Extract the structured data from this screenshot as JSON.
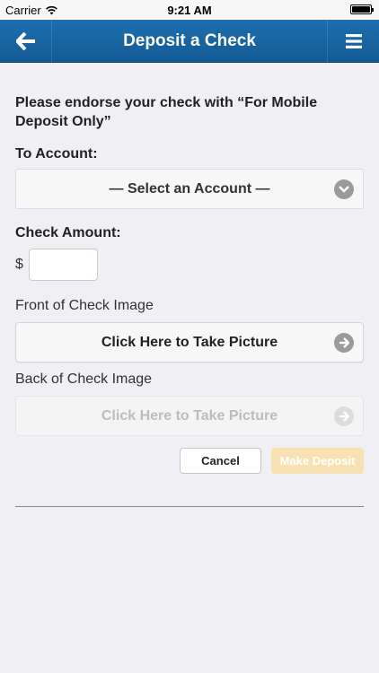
{
  "status_bar": {
    "carrier": "Carrier",
    "time": "9:21 AM",
    "battery_level": 1.0
  },
  "nav": {
    "title": "Deposit a Check",
    "back_icon": "back-arrow-icon",
    "menu_icon": "hamburger-menu-icon",
    "color": "#1a66a6"
  },
  "form": {
    "instruction": "Please endorse your check with “For Mobile Deposit Only”",
    "to_account_label": "To Account:",
    "account_select_value": "— Select an Account —",
    "check_amount_label": "Check Amount:",
    "currency_symbol": "$",
    "amount_value": "",
    "front_label": "Front of Check Image",
    "front_button": "Click Here to Take Picture",
    "back_label": "Back of Check Image",
    "back_button": "Click Here to Take Picture",
    "cancel_button": "Cancel",
    "deposit_button": "Make Deposit",
    "deposit_button_color": "#f8e2b3"
  }
}
